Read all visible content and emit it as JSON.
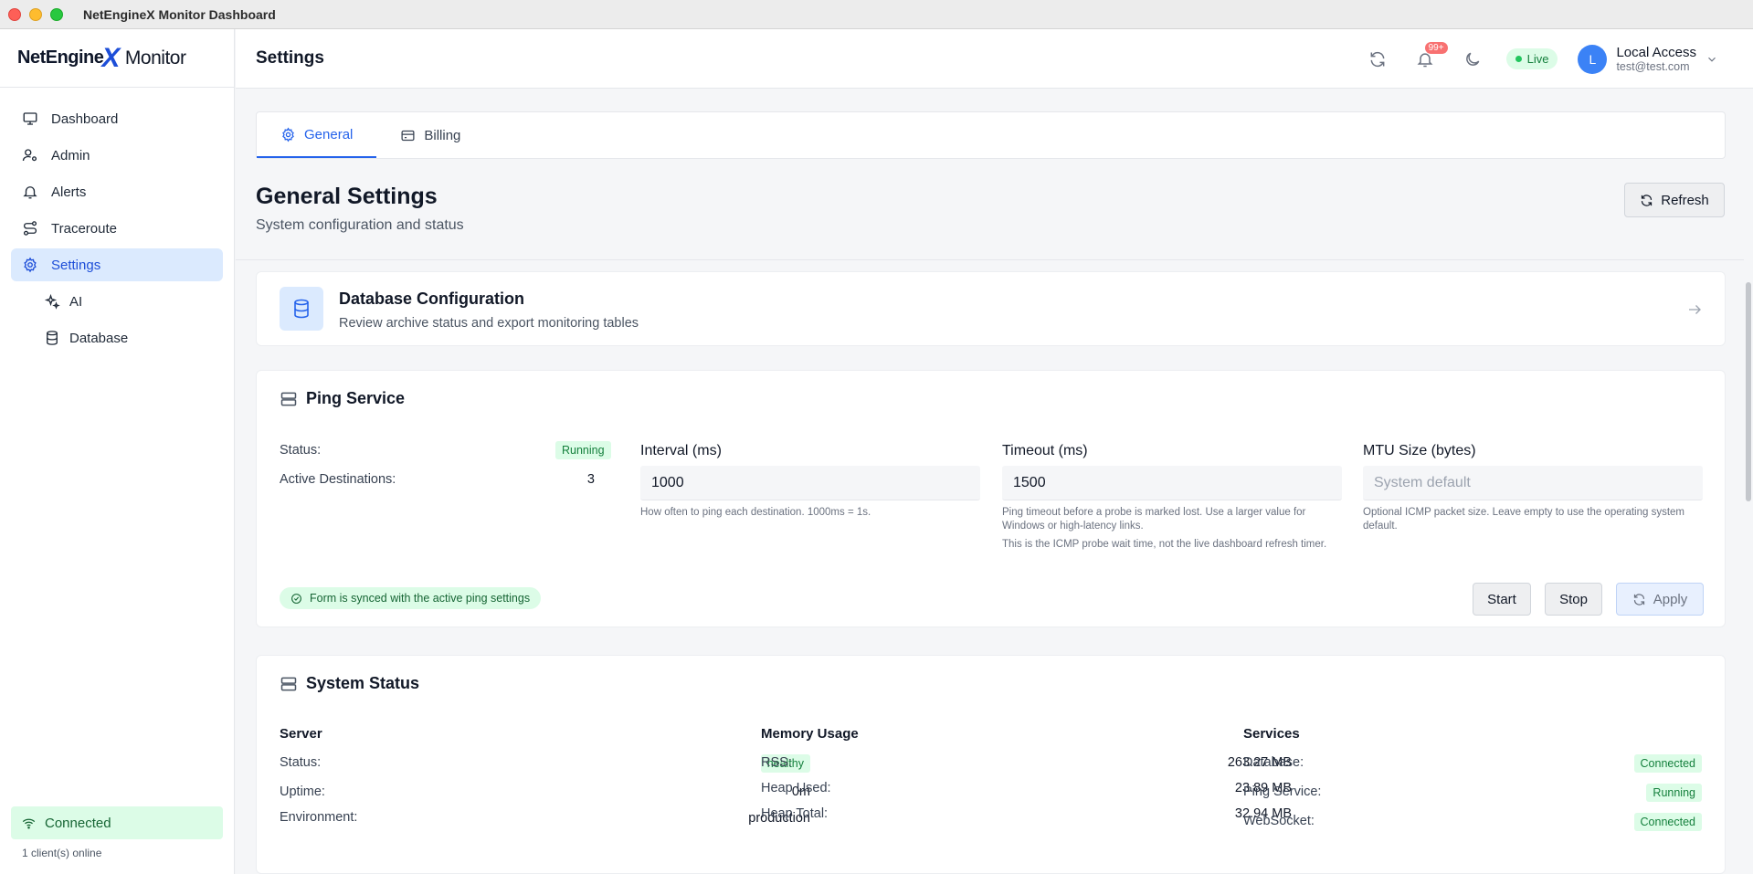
{
  "window": {
    "title": "NetEngineX Monitor Dashboard"
  },
  "brand": {
    "logo_text": "NetEngine",
    "logo_x": "X",
    "product": "Monitor"
  },
  "sidebar": {
    "items": [
      {
        "label": "Dashboard",
        "icon": "monitor-icon"
      },
      {
        "label": "Admin",
        "icon": "user-gear-icon"
      },
      {
        "label": "Alerts",
        "icon": "bell-icon"
      },
      {
        "label": "Traceroute",
        "icon": "route-icon"
      },
      {
        "label": "Settings",
        "icon": "gear-icon",
        "active": true
      },
      {
        "label": "AI",
        "icon": "sparkles-icon",
        "sub": true
      },
      {
        "label": "Database",
        "icon": "database-icon",
        "sub": true
      }
    ],
    "connection": {
      "label": "Connected",
      "clients": "1 client(s) online"
    }
  },
  "header": {
    "page_title": "Settings",
    "notification_badge": "99+",
    "live_label": "Live",
    "user": {
      "initial": "L",
      "name": "Local Access",
      "email": "test@test.com"
    }
  },
  "tabs": [
    {
      "label": "General",
      "icon": "gear-icon",
      "active": true
    },
    {
      "label": "Billing",
      "icon": "card-icon"
    }
  ],
  "general": {
    "title": "General Settings",
    "subtitle": "System configuration and status",
    "refresh_label": "Refresh"
  },
  "database_card": {
    "title": "Database Configuration",
    "subtitle": "Review archive status and export monitoring tables"
  },
  "ping_service": {
    "title": "Ping Service",
    "status_label": "Status:",
    "status_value": "Running",
    "active_dest_label": "Active Destinations:",
    "active_dest_value": "3",
    "interval": {
      "label": "Interval (ms)",
      "value": "1000",
      "help": "How often to ping each destination. 1000ms = 1s."
    },
    "timeout": {
      "label": "Timeout (ms)",
      "value": "1500",
      "help1": "Ping timeout before a probe is marked lost. Use a larger value for Windows or high-latency links.",
      "help2": "This is the ICMP probe wait time, not the live dashboard refresh timer."
    },
    "mtu": {
      "label": "MTU Size (bytes)",
      "placeholder": "System default",
      "help": "Optional ICMP packet size. Leave empty to use the operating system default."
    },
    "synced_message": "Form is synced with the active ping settings",
    "buttons": {
      "start": "Start",
      "stop": "Stop",
      "apply": "Apply"
    }
  },
  "system_status": {
    "title": "System Status",
    "server": {
      "heading": "Server",
      "rows": [
        {
          "label": "Status:",
          "value": "healthy",
          "pill": true
        },
        {
          "label": "Uptime:",
          "value": "0m"
        },
        {
          "label": "Environment:",
          "value": "production"
        }
      ]
    },
    "memory": {
      "heading": "Memory Usage",
      "rows": [
        {
          "label": "RSS:",
          "value": "263.27 MB"
        },
        {
          "label": "Heap Used:",
          "value": "23.89 MB"
        },
        {
          "label": "Heap Total:",
          "value": "32.94 MB"
        }
      ]
    },
    "services": {
      "heading": "Services",
      "rows": [
        {
          "label": "Database:",
          "value": "Connected",
          "pill": true
        },
        {
          "label": "Ping Service:",
          "value": "Running",
          "pill": true
        },
        {
          "label": "WebSocket:",
          "value": "Connected",
          "pill": true
        }
      ]
    }
  },
  "colors": {
    "accent": "#2563eb",
    "success_bg": "#dcfce7",
    "success_text": "#15803d",
    "active_nav_bg": "#dbeafe"
  }
}
